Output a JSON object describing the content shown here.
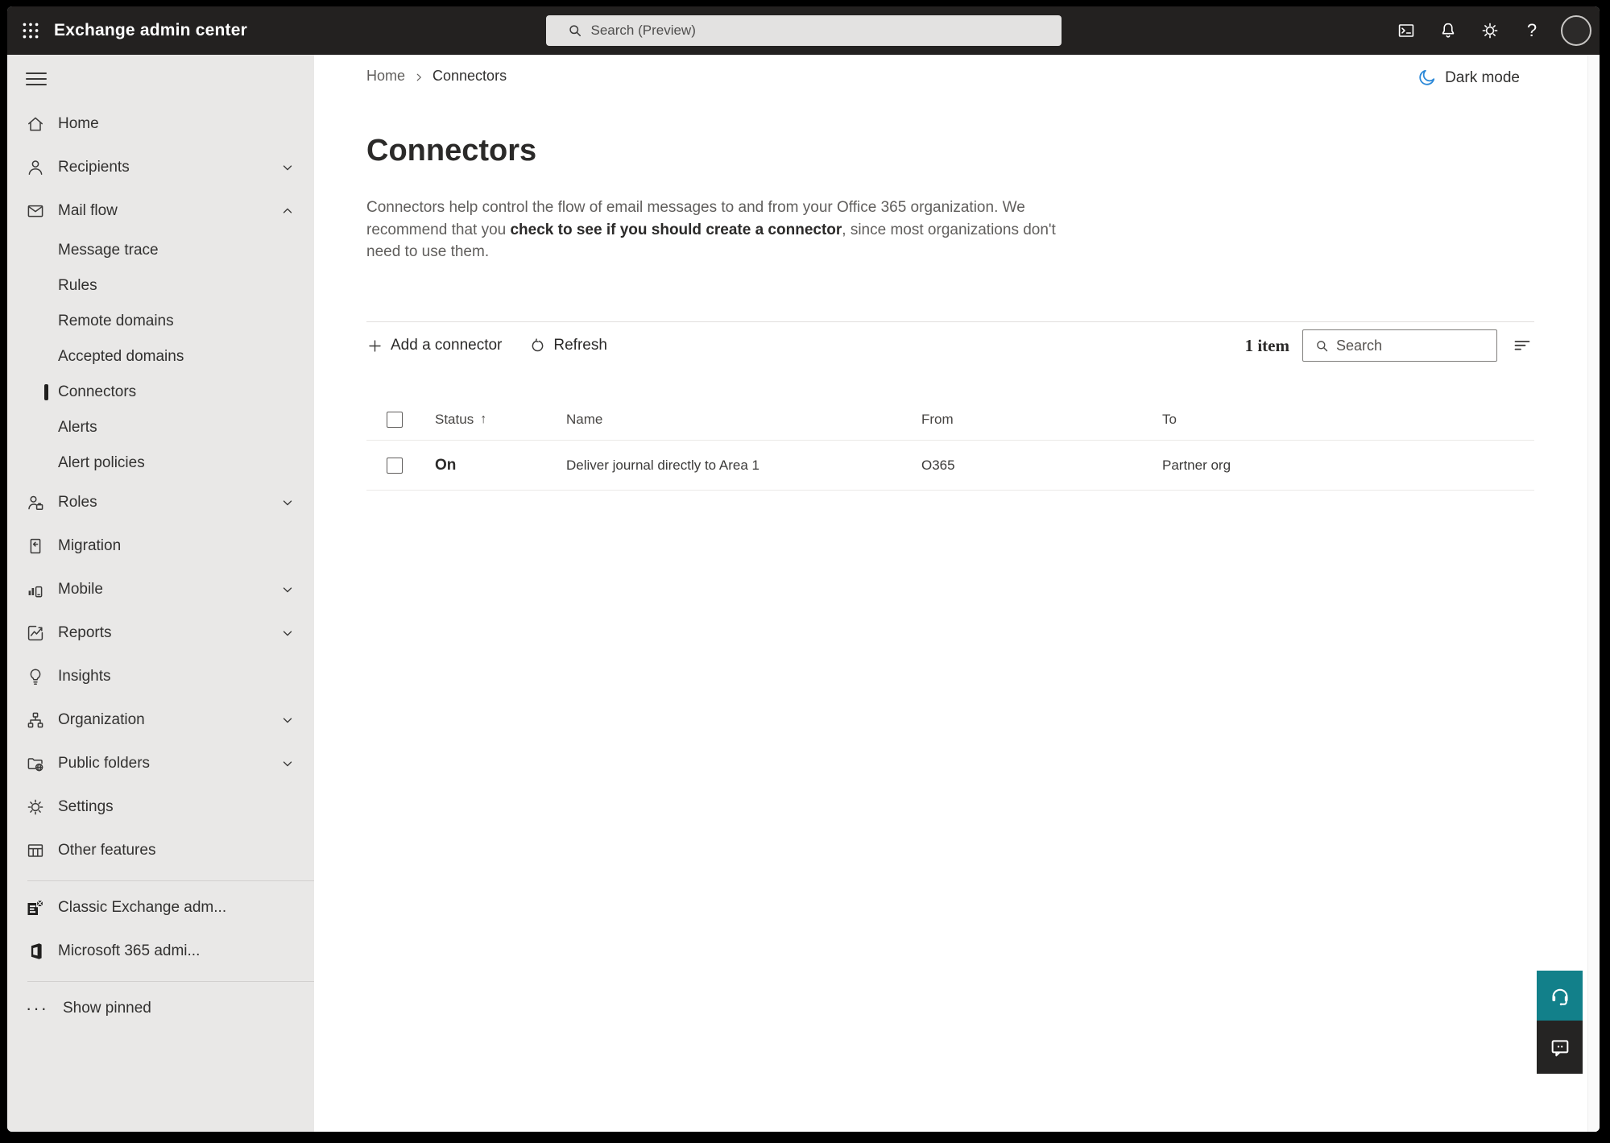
{
  "colors": {
    "topbar_bg": "#232120",
    "sidebar_bg": "#e9e8e7",
    "accent_moon_blue": "#2b88d8",
    "help_teal": "#12808a",
    "feedback_dark": "#252423",
    "text_primary": "#323130",
    "text_secondary": "#605e5c"
  },
  "topbar": {
    "app_launcher_icon": "waffle-icon",
    "title": "Exchange admin center",
    "search_placeholder": "Search (Preview)",
    "icons": [
      "terminal-icon",
      "bell-icon",
      "gear-icon",
      "help-icon",
      "avatar"
    ],
    "help_glyph": "?"
  },
  "sidebar": {
    "hamburger_icon": "hamburger-icon",
    "items": [
      {
        "label": "Home",
        "icon": "home-icon",
        "kind": "top"
      },
      {
        "label": "Recipients",
        "icon": "person-icon",
        "kind": "top",
        "chevron": "down"
      },
      {
        "label": "Mail flow",
        "icon": "mail-icon",
        "kind": "top",
        "chevron": "up"
      },
      {
        "label": "Message trace",
        "kind": "sub"
      },
      {
        "label": "Rules",
        "kind": "sub"
      },
      {
        "label": "Remote domains",
        "kind": "sub"
      },
      {
        "label": "Accepted domains",
        "kind": "sub"
      },
      {
        "label": "Connectors",
        "kind": "sub",
        "selected": true
      },
      {
        "label": "Alerts",
        "kind": "sub"
      },
      {
        "label": "Alert policies",
        "kind": "sub"
      },
      {
        "label": "Roles",
        "icon": "roles-icon",
        "kind": "top",
        "chevron": "down"
      },
      {
        "label": "Migration",
        "icon": "migration-icon",
        "kind": "top"
      },
      {
        "label": "Mobile",
        "icon": "mobile-icon",
        "kind": "top",
        "chevron": "down"
      },
      {
        "label": "Reports",
        "icon": "reports-icon",
        "kind": "top",
        "chevron": "down"
      },
      {
        "label": "Insights",
        "icon": "lightbulb-icon",
        "kind": "top"
      },
      {
        "label": "Organization",
        "icon": "org-chart-icon",
        "kind": "top",
        "chevron": "down"
      },
      {
        "label": "Public folders",
        "icon": "public-folders-icon",
        "kind": "top",
        "chevron": "down"
      },
      {
        "label": "Settings",
        "icon": "gear-icon",
        "kind": "top"
      },
      {
        "label": "Other features",
        "icon": "table-icon",
        "kind": "top"
      }
    ],
    "footer_items": [
      {
        "label": "Classic Exchange adm...",
        "icon": "exchange-logo-icon"
      },
      {
        "label": "Microsoft 365 admi...",
        "icon": "microsoft365-logo-icon"
      }
    ],
    "show_pinned_label": "Show pinned",
    "ellipsis_glyph": "···"
  },
  "main": {
    "breadcrumb": {
      "home": "Home",
      "current": "Connectors"
    },
    "dark_mode_label": "Dark mode",
    "title": "Connectors",
    "description": {
      "pre": "Connectors help control the flow of email messages to and from your Office 365 organization. We recommend that you ",
      "link": "check to see if you should create a connector",
      "post": ", since most organizations don't need to use them."
    },
    "toolbar": {
      "add_label": "Add a connector",
      "refresh_label": "Refresh",
      "count": "1 item",
      "search_placeholder": "Search"
    },
    "table": {
      "headers": [
        "Status",
        "Name",
        "From",
        "To"
      ],
      "sort_arrow": "↑",
      "rows": [
        {
          "status": "On",
          "name": "Deliver journal directly to Area 1",
          "from": "O365",
          "to": "Partner org"
        }
      ]
    }
  }
}
